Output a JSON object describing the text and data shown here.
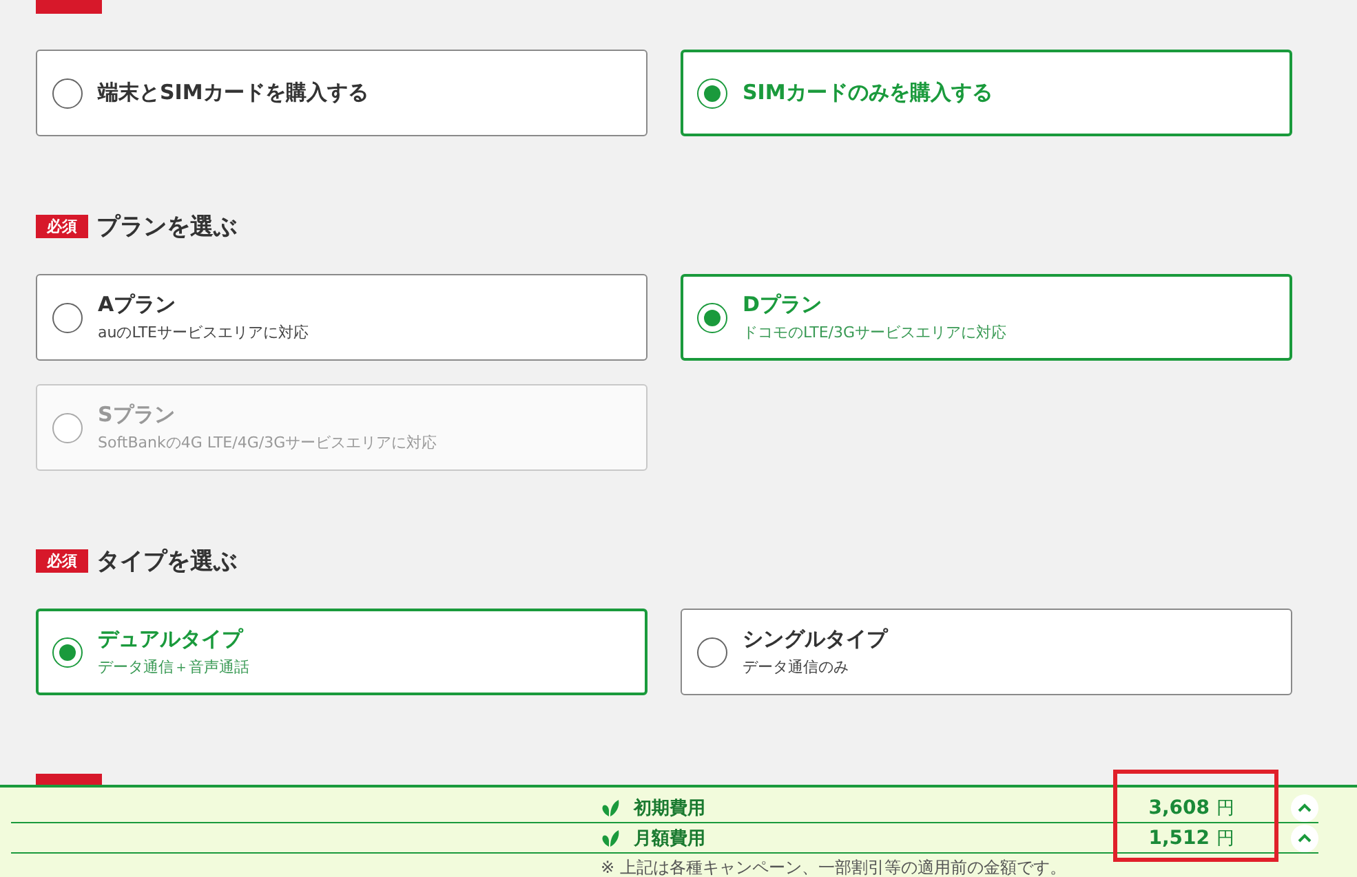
{
  "sections": [
    {
      "kind": "cut_heading",
      "options": [
        {
          "title": "端末とSIMカードを購入する",
          "selected": false,
          "disabled": false
        },
        {
          "title": "SIMカードのみを購入する",
          "selected": true,
          "disabled": false
        }
      ]
    },
    {
      "required_label": "必須",
      "title": "プランを選ぶ",
      "options": [
        {
          "title": "Aプラン",
          "description": "auのLTEサービスエリアに対応",
          "selected": false,
          "disabled": false
        },
        {
          "title": "Dプラン",
          "description": "ドコモのLTE/3Gサービスエリアに対応",
          "selected": true,
          "disabled": false
        },
        {
          "title": "Sプラン",
          "description": "SoftBankの4G LTE/4G/3Gサービスエリアに対応",
          "selected": false,
          "disabled": true
        }
      ]
    },
    {
      "required_label": "必須",
      "title": "タイプを選ぶ",
      "options": [
        {
          "title": "デュアルタイプ",
          "description": "データ通信＋音声通話",
          "selected": true,
          "disabled": false
        },
        {
          "title": "シングルタイプ",
          "description": "データ通信のみ",
          "selected": false,
          "disabled": false
        }
      ]
    },
    {
      "kind": "cut_heading"
    }
  ],
  "cost_bar": {
    "rows": [
      {
        "label": "初期費用",
        "amount": "3,608",
        "unit": "円"
      },
      {
        "label": "月額費用",
        "amount": "1,512",
        "unit": "円"
      }
    ],
    "note": "※ 上記は各種キャンペーン、一部割引等の適用前の金額です。"
  }
}
